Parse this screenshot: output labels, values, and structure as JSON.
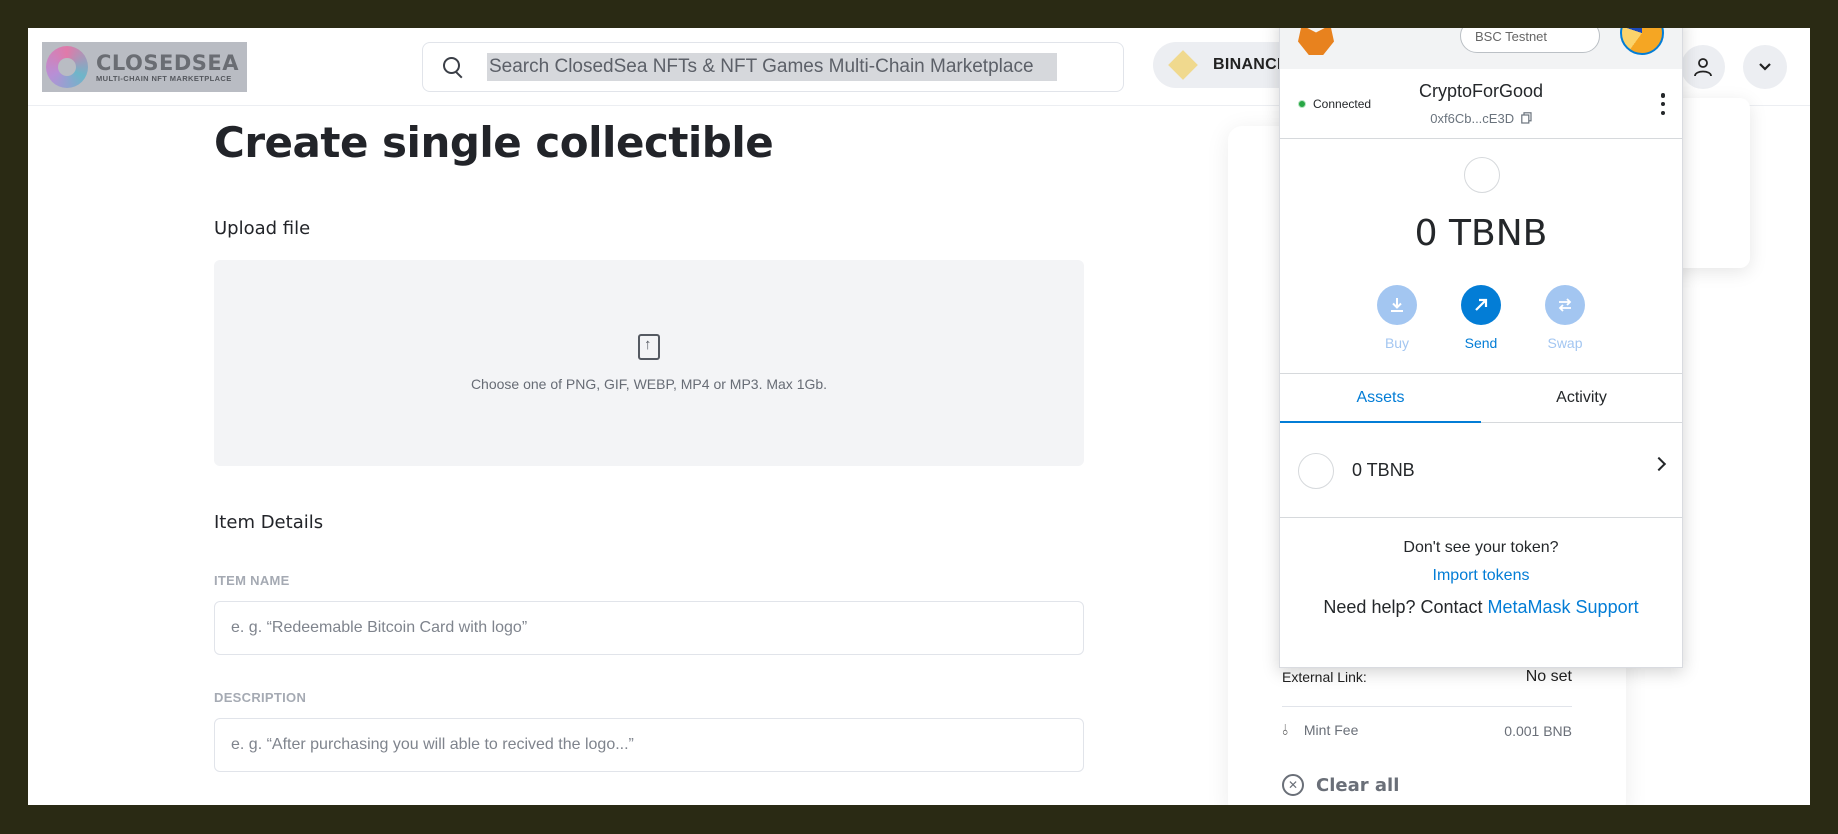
{
  "header": {
    "logo_title": "CLOSEDSEA",
    "logo_subtitle": "MULTI-CHAIN NFT MARKETPLACE",
    "search_placeholder": "Search ClosedSea NFTs & NFT Games Multi-Chain Marketplace",
    "network_label": "BINANCE"
  },
  "main": {
    "title": "Create single collectible",
    "upload_label": "Upload file",
    "upload_hint": "Choose one of PNG, GIF, WEBP, MP4 or MP3. Max 1Gb.",
    "item_details_label": "Item Details",
    "fields": [
      {
        "label": "ITEM NAME",
        "placeholder": "e. g. “Redeemable Bitcoin Card with logo”"
      },
      {
        "label": "DESCRIPTION",
        "placeholder": "e. g. “After purchasing you will able to recived the logo...”"
      }
    ]
  },
  "preview": {
    "external_link_label": "External Link:",
    "external_link_value": "No set",
    "mint_fee_label": "Mint Fee",
    "mint_fee_value": "0.001 BNB",
    "clear_all": "Clear all"
  },
  "wallet": {
    "network": "BSC Testnet",
    "status": "Connected",
    "account_name": "CryptoForGood",
    "account_address": "0xf6Cb...cE3D",
    "balance": "0 TBNB",
    "actions": [
      {
        "label": "Buy",
        "icon": "download-icon",
        "color": "#a3c6f1",
        "enabled": false
      },
      {
        "label": "Send",
        "icon": "arrow-up-right-icon",
        "color": "#037dd6",
        "enabled": true
      },
      {
        "label": "Swap",
        "icon": "swap-icon",
        "color": "#a3c6f1",
        "enabled": false
      }
    ],
    "tabs": [
      "Assets",
      "Activity"
    ],
    "asset_row": "0 TBNB",
    "missing_token_question": "Don't see your token?",
    "import_tokens": "Import tokens",
    "help_prefix": "Need help? Contact ",
    "help_link": "MetaMask Support"
  },
  "colors": {
    "accent": "#037dd6",
    "muted_action": "#a3c6f1",
    "frame_bg": "#2a2a14"
  }
}
